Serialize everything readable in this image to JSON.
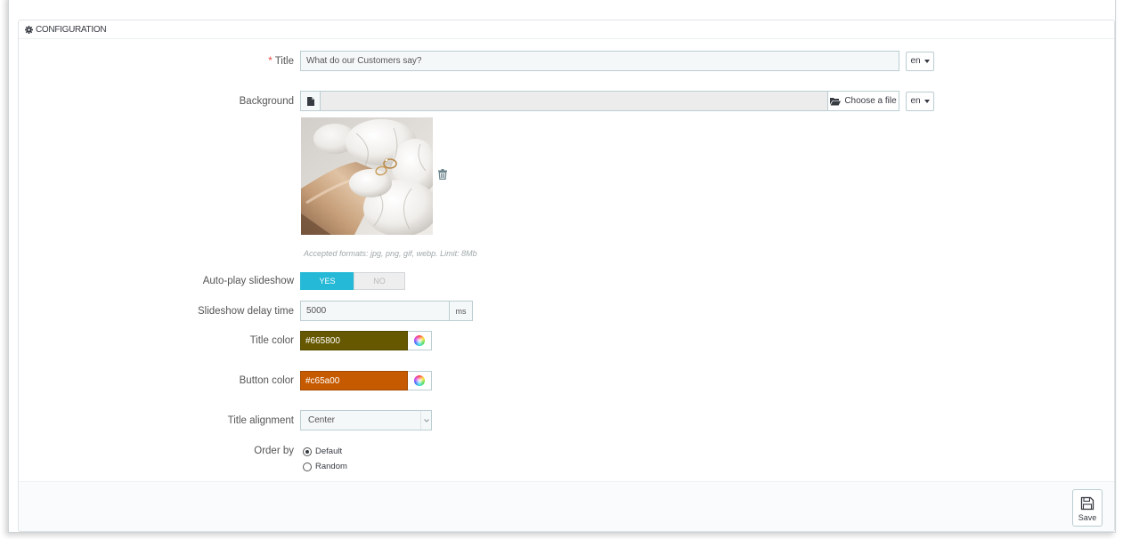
{
  "panel": {
    "title": "CONFIGURATION",
    "icon": "gear-icon"
  },
  "form": {
    "title": {
      "required_mark": "*",
      "label": "Title",
      "value": "What do our Customers say?",
      "language": "en"
    },
    "background": {
      "label": "Background",
      "file_icon": "file-icon",
      "file_name": "",
      "choose_button_label": "Choose a file",
      "choose_button_icon": "folder-open-icon",
      "language": "en",
      "delete_icon": "trash-icon",
      "help_text": "Accepted formats: jpg, png, gif, webp. Limit: 8Mb"
    },
    "autoplay": {
      "label": "Auto-play slideshow",
      "yes_label": "YES",
      "no_label": "NO",
      "enabled": true
    },
    "delay": {
      "label": "Slideshow delay time",
      "value": "5000",
      "unit": "ms"
    },
    "title_color": {
      "label": "Title color",
      "value": "#665800",
      "picker_icon": "color-wheel-icon"
    },
    "button_color": {
      "label": "Button color",
      "value": "#c65a00",
      "picker_icon": "color-wheel-icon"
    },
    "title_alignment": {
      "label": "Title alignment",
      "selected": "Center"
    },
    "order_by": {
      "label": "Order by",
      "options": [
        {
          "label": "Default",
          "checked": true
        },
        {
          "label": "Random",
          "checked": false
        }
      ]
    }
  },
  "footer": {
    "save_label": "Save",
    "save_icon": "save-icon"
  },
  "colors": {
    "toggle_active": "#25b9d7",
    "required_mark": "#e0473b"
  }
}
